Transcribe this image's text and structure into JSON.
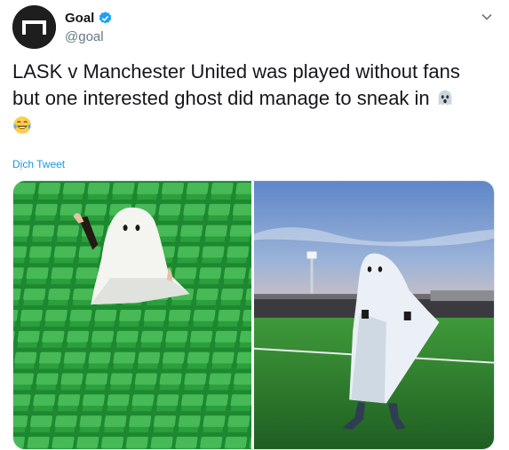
{
  "account": {
    "display_name": "Goal",
    "handle": "@goal",
    "verified": true,
    "avatar_icon": "goal-logo-icon"
  },
  "tweet": {
    "text_line1": "LASK v Manchester United was played without fans",
    "text_line2": "but one interested ghost did manage to sneak in",
    "emoji_ghost": "ghost-emoji-icon",
    "emoji_laugh": "joy-emoji-icon"
  },
  "translate_label": "Dịch Tweet",
  "media": {
    "photos": [
      {
        "name": "ghost-in-stand-photo"
      },
      {
        "name": "ghost-on-pitch-photo"
      }
    ]
  },
  "colors": {
    "accent": "#1b95e0",
    "verified": "#1da1f2",
    "text": "#14171a",
    "secondary_text": "#657786"
  }
}
